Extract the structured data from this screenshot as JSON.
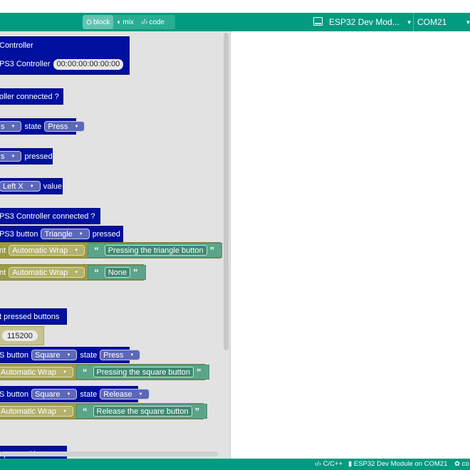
{
  "toolbar": {
    "modes": [
      {
        "icon": "⛭",
        "label": "block"
      },
      {
        "icon": "◐",
        "label": "mix"
      },
      {
        "icon": "‹/›",
        "label": "code"
      }
    ],
    "board": "ESP32 Dev Mod...",
    "port": "COM21",
    "caret": "▼"
  },
  "blocks": {
    "controller_title": "Controller",
    "ps3_controller_label": "PS3 Controller",
    "mac_address": "00:00:00:00:00:00",
    "connected_q": "oller connected ?",
    "state_s": "s",
    "state_word": "state",
    "state_press": "Press",
    "pressed_s": "s",
    "pressed_word": "pressed",
    "analog_sel": "Left X",
    "value_word": "value",
    "if_connected": "PS3 Controller connected ?",
    "ps3_button": "PS3 button",
    "triangle": "Triangle",
    "tri_pressed": "pressed",
    "print_nt": "nt",
    "auto_wrap": "Automatic Wrap",
    "str_triangle": "Pressing the triangle button",
    "print_nt2": "nt",
    "auto_wrap2": "Automatic Wrap",
    "str_none": "None",
    "print_pressed": "t pressed buttons",
    "baud": "115200",
    "btn_s1": "S button",
    "square1": "Square",
    "state1": "state",
    "press1": "Press",
    "auto_wrap3": "Automatic Wrap",
    "str_square_press": "Pressing the square button",
    "btn_s2": "S button",
    "square2": "Square",
    "state2": "state",
    "release2": "Release",
    "auto_wrap4": "Automatic Wrap",
    "str_square_release": "Release the square button",
    "print_pressed2": "t pressed buttons",
    "quote_open": "“",
    "quote_close": "”",
    "tri": "▼"
  },
  "statusbar": {
    "lang": "‹/› C/C++",
    "board_port": "ESP32 Dev Module on COM21",
    "settings": "co"
  },
  "colors": {
    "accent": "#009b80",
    "block_blue": "#00109e",
    "block_olive": "#9c9a45",
    "block_teal": "#5ba48a",
    "workspace": "#e2e2e2"
  }
}
